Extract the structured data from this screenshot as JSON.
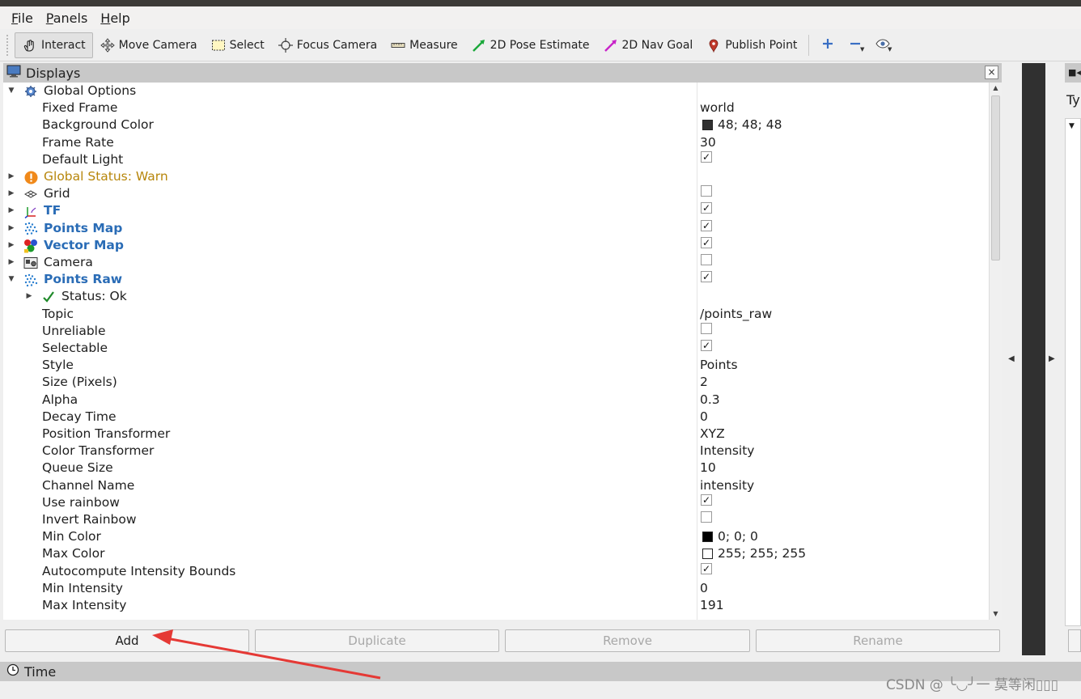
{
  "menu": [
    {
      "accel": "F",
      "rest": "ile"
    },
    {
      "accel": "P",
      "rest": "anels"
    },
    {
      "accel": "H",
      "rest": "elp"
    }
  ],
  "toolbar": {
    "interact": "Interact",
    "move_camera": "Move Camera",
    "select": "Select",
    "focus_camera": "Focus Camera",
    "measure": "Measure",
    "pose_estimate": "2D Pose Estimate",
    "nav_goal": "2D Nav Goal",
    "publish_point": "Publish Point"
  },
  "displays": {
    "title": "Displays",
    "close": "×",
    "rows": [
      {
        "indent": 0,
        "arrow": "down",
        "icon": "gear-icon",
        "name": "Global Options",
        "style": "",
        "value": null
      },
      {
        "indent": 1,
        "arrow": "",
        "icon": "",
        "name": "Fixed Frame",
        "style": "",
        "value": {
          "type": "text",
          "text": "world"
        }
      },
      {
        "indent": 1,
        "arrow": "",
        "icon": "",
        "name": "Background Color",
        "style": "",
        "value": {
          "type": "color",
          "color": "#303030",
          "text": "48; 48; 48"
        }
      },
      {
        "indent": 1,
        "arrow": "",
        "icon": "",
        "name": "Frame Rate",
        "style": "",
        "value": {
          "type": "text",
          "text": "30"
        }
      },
      {
        "indent": 1,
        "arrow": "",
        "icon": "",
        "name": "Default Light",
        "style": "",
        "value": {
          "type": "check",
          "checked": true
        }
      },
      {
        "indent": 0,
        "arrow": "right",
        "icon": "warning-icon",
        "name": "Global Status: Warn",
        "style": "warn",
        "value": null
      },
      {
        "indent": 0,
        "arrow": "right",
        "icon": "grid-icon",
        "name": "Grid",
        "style": "",
        "value": {
          "type": "check",
          "checked": false
        }
      },
      {
        "indent": 0,
        "arrow": "right",
        "icon": "tf-icon",
        "name": "TF",
        "style": "blue",
        "value": {
          "type": "check",
          "checked": true
        }
      },
      {
        "indent": 0,
        "arrow": "right",
        "icon": "pointcloud-icon",
        "name": "Points Map",
        "style": "blue",
        "value": {
          "type": "check",
          "checked": true
        }
      },
      {
        "indent": 0,
        "arrow": "right",
        "icon": "marker-array-icon",
        "name": "Vector Map",
        "style": "blue",
        "value": {
          "type": "check",
          "checked": true
        }
      },
      {
        "indent": 0,
        "arrow": "right",
        "icon": "camera-icon",
        "name": "Camera",
        "style": "",
        "value": {
          "type": "check",
          "checked": false
        }
      },
      {
        "indent": 0,
        "arrow": "down",
        "icon": "pointcloud-icon",
        "name": "Points Raw",
        "style": "blue",
        "value": {
          "type": "check",
          "checked": true
        }
      },
      {
        "indent": 1,
        "arrow": "right",
        "icon": "check-icon",
        "name": "Status: Ok",
        "style": "",
        "value": null
      },
      {
        "indent": 1,
        "arrow": "",
        "icon": "",
        "name": "Topic",
        "style": "",
        "value": {
          "type": "text",
          "text": "/points_raw"
        }
      },
      {
        "indent": 1,
        "arrow": "",
        "icon": "",
        "name": "Unreliable",
        "style": "",
        "value": {
          "type": "check",
          "checked": false
        }
      },
      {
        "indent": 1,
        "arrow": "",
        "icon": "",
        "name": "Selectable",
        "style": "",
        "value": {
          "type": "check",
          "checked": true
        }
      },
      {
        "indent": 1,
        "arrow": "",
        "icon": "",
        "name": "Style",
        "style": "",
        "value": {
          "type": "text",
          "text": "Points"
        }
      },
      {
        "indent": 1,
        "arrow": "",
        "icon": "",
        "name": "Size (Pixels)",
        "style": "",
        "value": {
          "type": "text",
          "text": "2"
        }
      },
      {
        "indent": 1,
        "arrow": "",
        "icon": "",
        "name": "Alpha",
        "style": "",
        "value": {
          "type": "text",
          "text": "0.3"
        }
      },
      {
        "indent": 1,
        "arrow": "",
        "icon": "",
        "name": "Decay Time",
        "style": "",
        "value": {
          "type": "text",
          "text": "0"
        }
      },
      {
        "indent": 1,
        "arrow": "",
        "icon": "",
        "name": "Position Transformer",
        "style": "",
        "value": {
          "type": "text",
          "text": "XYZ"
        }
      },
      {
        "indent": 1,
        "arrow": "",
        "icon": "",
        "name": "Color Transformer",
        "style": "",
        "value": {
          "type": "text",
          "text": "Intensity"
        }
      },
      {
        "indent": 1,
        "arrow": "",
        "icon": "",
        "name": "Queue Size",
        "style": "",
        "value": {
          "type": "text",
          "text": "10"
        }
      },
      {
        "indent": 1,
        "arrow": "",
        "icon": "",
        "name": "Channel Name",
        "style": "",
        "value": {
          "type": "text",
          "text": "intensity"
        }
      },
      {
        "indent": 1,
        "arrow": "",
        "icon": "",
        "name": "Use rainbow",
        "style": "",
        "value": {
          "type": "check",
          "checked": true
        }
      },
      {
        "indent": 1,
        "arrow": "",
        "icon": "",
        "name": "Invert Rainbow",
        "style": "",
        "value": {
          "type": "check",
          "checked": false
        }
      },
      {
        "indent": 1,
        "arrow": "",
        "icon": "",
        "name": "Min Color",
        "style": "",
        "value": {
          "type": "color",
          "color": "#000000",
          "text": "0; 0; 0"
        }
      },
      {
        "indent": 1,
        "arrow": "",
        "icon": "",
        "name": "Max Color",
        "style": "",
        "value": {
          "type": "color",
          "color": "#ffffff",
          "text": "255; 255; 255"
        }
      },
      {
        "indent": 1,
        "arrow": "",
        "icon": "",
        "name": "Autocompute Intensity Bounds",
        "style": "",
        "value": {
          "type": "check",
          "checked": true
        }
      },
      {
        "indent": 1,
        "arrow": "",
        "icon": "",
        "name": "Min Intensity",
        "style": "",
        "value": {
          "type": "text",
          "text": "0"
        }
      },
      {
        "indent": 1,
        "arrow": "",
        "icon": "",
        "name": "Max Intensity",
        "style": "",
        "value": {
          "type": "text",
          "text": "191"
        }
      }
    ],
    "buttons": {
      "add": "Add",
      "duplicate": "Duplicate",
      "remove": "Remove",
      "rename": "Rename"
    }
  },
  "right_panel": {
    "type_label": "Ty"
  },
  "time_panel": {
    "title": "Time"
  },
  "watermark": "CSDN @ ╰◡╯一 莫等闲▯▯▯",
  "colors": {
    "warn": "#b7860b",
    "display_blue": "#2a6cb6",
    "annotation_arrow": "#e53935"
  }
}
